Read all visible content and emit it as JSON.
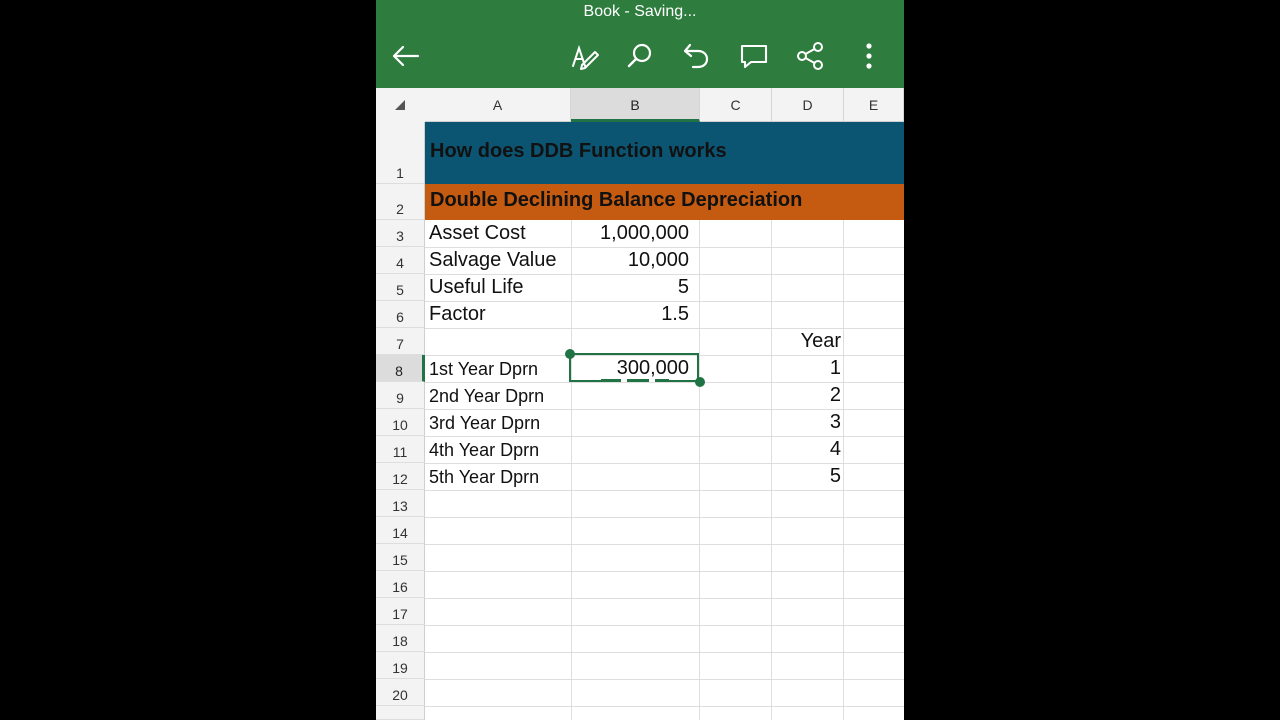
{
  "app": {
    "title": "Book - Saving...",
    "toolbar": {
      "back": "arrow-left-icon",
      "draw": "pen-icon",
      "search": "search-icon",
      "undo": "undo-icon",
      "comment": "comment-icon",
      "share": "share-icon",
      "more": "more-vertical-icon"
    },
    "colors": {
      "appbar": "#2e7d3e",
      "selection": "#217346",
      "title_band": "#0b5572",
      "subtitle_band": "#c55a11"
    }
  },
  "sheet": {
    "columns": [
      "A",
      "B",
      "C",
      "D",
      "E"
    ],
    "selected_column": "B",
    "rows": [
      "1",
      "2",
      "3",
      "4",
      "5",
      "6",
      "7",
      "8",
      "9",
      "10",
      "11",
      "12",
      "13",
      "14",
      "15",
      "16",
      "17",
      "18",
      "19",
      "20"
    ],
    "selected_row": "8",
    "title": "How does DDB Function works",
    "subtitle": "Double Declining Balance Depreciation",
    "inputs": [
      {
        "label": "Asset Cost",
        "value": "1,000,000"
      },
      {
        "label": "Salvage Value",
        "value": "10,000"
      },
      {
        "label": "Useful Life",
        "value": "5"
      },
      {
        "label": "Factor",
        "value": "1.5"
      }
    ],
    "year_header": "Year",
    "schedule": [
      {
        "label": "1st Year Dprn",
        "value": "300,000",
        "year": "1"
      },
      {
        "label": "2nd Year Dprn",
        "value": "",
        "year": "2"
      },
      {
        "label": "3rd Year Dprn",
        "value": "",
        "year": "3"
      },
      {
        "label": "4th Year Dprn",
        "value": "",
        "year": "4"
      },
      {
        "label": "5th Year Dprn",
        "value": "",
        "year": "5"
      }
    ]
  }
}
